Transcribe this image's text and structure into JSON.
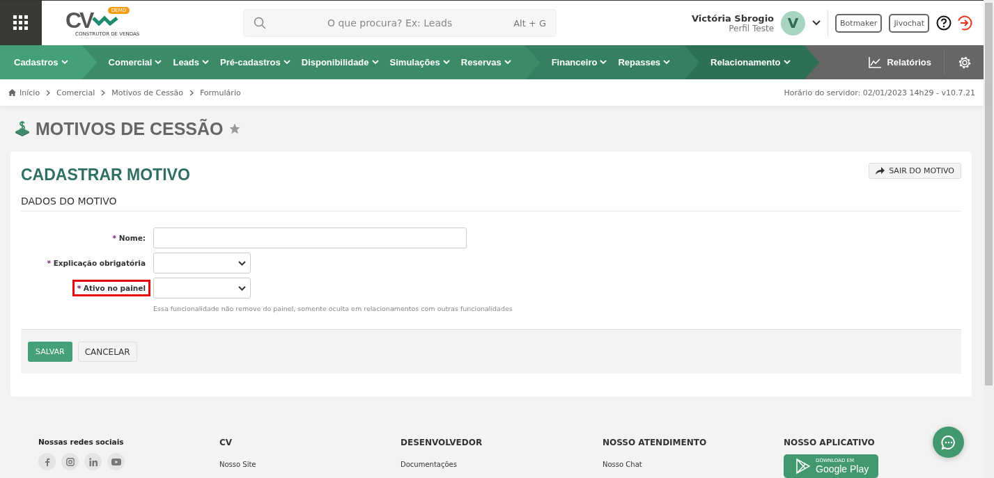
{
  "header": {
    "logo": {
      "text": "CV",
      "badge": "DEMO",
      "tagline": "CONSTRUTOR DE VENDAS"
    },
    "search": {
      "placeholder": "O que procura? Ex: Leads",
      "shortcut": "Alt + G"
    },
    "user": {
      "name": "Victória Sbrogio",
      "profile": "Perfil Teste",
      "initial": "V"
    },
    "buttons": [
      "Botmaker",
      "Jivochat"
    ]
  },
  "nav": {
    "groups": [
      {
        "color": "#43a077",
        "items": [
          "Cadastros"
        ]
      },
      {
        "color": "#3b8a68",
        "items": [
          "Comercial",
          "Leads",
          "Pré-cadastros",
          "Disponibilidade",
          "Simulações",
          "Reservas"
        ]
      },
      {
        "color": "#358062",
        "items": [
          "Financeiro",
          "Repasses"
        ]
      },
      {
        "color": "#2e7056",
        "items": [
          "Relacionamento"
        ]
      }
    ],
    "reports": "Relatórios"
  },
  "breadcrumb": [
    "Início",
    "Comercial",
    "Motivos de Cessão",
    "Formulário"
  ],
  "server_time": "Horário do servidor: 02/01/2023 14h29 - v10.7.21",
  "page_title": "MOTIVOS DE CESSÃO",
  "form": {
    "title": "CADASTRAR MOTIVO",
    "exit_button": "SAIR DO MOTIVO",
    "section": "DADOS DO MOTIVO",
    "fields": [
      {
        "kind": "text",
        "mark": "*",
        "label": "Nome:",
        "highlighted": false
      },
      {
        "kind": "select",
        "mark": "*",
        "label": "Explicação obrigatória",
        "highlighted": false
      },
      {
        "kind": "select",
        "mark": "*",
        "label": "Ativo no painel",
        "highlighted": true,
        "help": "Essa funcionalidade não remove do painel, somente oculta em relacionamentos com outras funcionalidades"
      }
    ],
    "save": "SALVAR",
    "cancel": "CANCELAR"
  },
  "footer": {
    "social_title": "Nossas redes sociais",
    "columns": [
      {
        "title": "CV",
        "links": [
          "Nosso Site"
        ]
      },
      {
        "title": "DESENVOLVEDOR",
        "links": [
          "Documentações"
        ]
      },
      {
        "title": "NOSSO ATENDIMENTO",
        "links": [
          "Nosso Chat"
        ]
      }
    ],
    "app": {
      "title": "NOSSO APLICATIVO",
      "badge_small": "DOWNLOAD EM",
      "badge_large": "Google Play"
    }
  }
}
